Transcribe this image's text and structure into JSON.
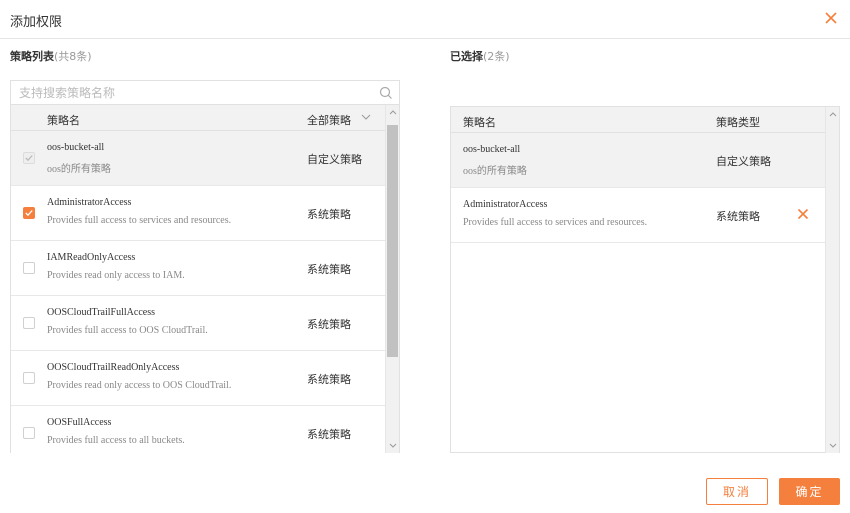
{
  "dialog": {
    "title": "添加权限"
  },
  "left": {
    "label": "策略列表",
    "count": "(共8条)",
    "search_placeholder": "支持搜索策略名称",
    "header": {
      "name": "策略名",
      "type": "全部策略"
    },
    "rows": [
      {
        "name": "oos-bucket-all",
        "desc": "oos的所有策略",
        "type": "自定义策略",
        "state": "disabled-checked"
      },
      {
        "name": "AdministratorAccess",
        "desc": "Provides full access to services and resources.",
        "type": "系统策略",
        "state": "checked"
      },
      {
        "name": "IAMReadOnlyAccess",
        "desc": "Provides read only access to IAM.",
        "type": "系统策略",
        "state": "unchecked"
      },
      {
        "name": "OOSCloudTrailFullAccess",
        "desc": "Provides full access to OOS CloudTrail.",
        "type": "系统策略",
        "state": "unchecked"
      },
      {
        "name": "OOSCloudTrailReadOnlyAccess",
        "desc": "Provides read only access to OOS CloudTrail.",
        "type": "系统策略",
        "state": "unchecked"
      },
      {
        "name": "OOSFullAccess",
        "desc": "Provides full access to all buckets.",
        "type": "系统策略",
        "state": "unchecked"
      }
    ]
  },
  "right": {
    "label": "已选择",
    "count": "(2条)",
    "header": {
      "name": "策略名",
      "type": "策略类型"
    },
    "rows": [
      {
        "name": "oos-bucket-all",
        "desc": "oos的所有策略",
        "type": "自定义策略",
        "removable": false
      },
      {
        "name": "AdministratorAccess",
        "desc": "Provides full access to services and resources.",
        "type": "系统策略",
        "removable": true
      }
    ]
  },
  "buttons": {
    "cancel": "取消",
    "ok": "确定"
  },
  "colors": {
    "accent": "#f5803e",
    "border": "#e1e1e1",
    "header_bg": "#f2f2f2"
  }
}
